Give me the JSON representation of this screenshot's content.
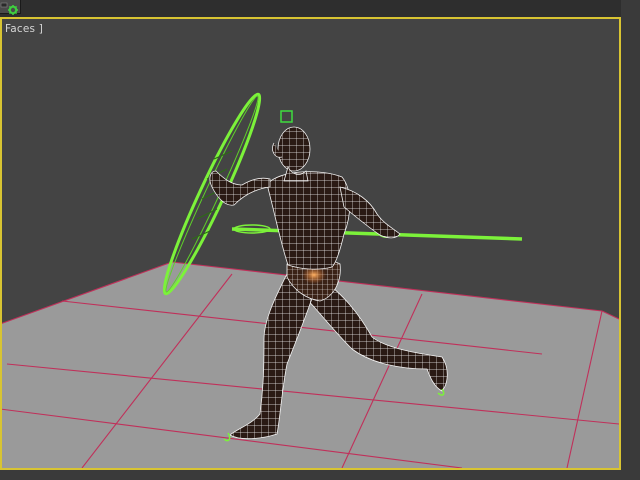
{
  "viewport": {
    "label": "Faces ]",
    "border_color": "#d8c432",
    "background_color": "#444444"
  },
  "toolbar": {
    "icon": "settings-gear-icon",
    "icon_color": "#3fcf3f"
  },
  "scene": {
    "floor_color": "#9a9a9a",
    "grid_line_color": "#c0305a",
    "mesh_wire_color": "#f2f2f2",
    "mesh_fill_color": "#2a1a14",
    "selection_color": "#7cf23a",
    "highlight_color": "#e0873a"
  }
}
